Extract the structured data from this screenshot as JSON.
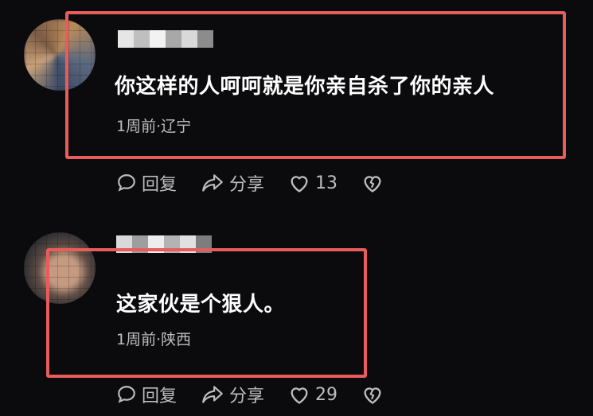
{
  "comments": [
    {
      "text": "你这样的人呵呵就是你亲自杀了你的亲人",
      "meta": "1周前·辽宁",
      "actions": {
        "reply": "回复",
        "share": "分享",
        "likes": "13"
      }
    },
    {
      "text": "这家伙是个狠人。",
      "meta": "1周前·陕西",
      "actions": {
        "reply": "回复",
        "share": "分享",
        "likes": "29"
      }
    }
  ],
  "colors": {
    "background": "#0b0b0d",
    "highlight": "#e85c5c",
    "meta_text": "#bdbdbd"
  },
  "icons": [
    "comment-icon",
    "share-icon",
    "heart-icon",
    "broken-heart-icon"
  ]
}
